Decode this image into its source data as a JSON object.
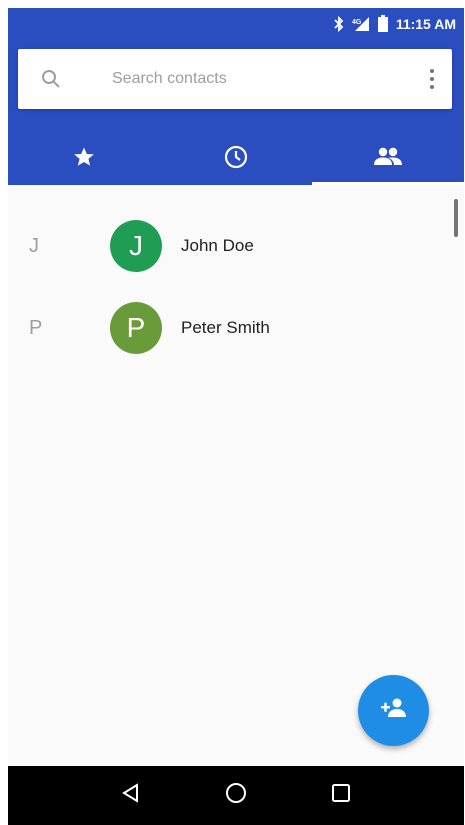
{
  "status_bar": {
    "time": "11:15 AM",
    "icons": [
      "bluetooth-icon",
      "signal-icon",
      "battery-icon"
    ]
  },
  "search": {
    "placeholder": "Search contacts"
  },
  "tabs": [
    {
      "icon": "star-icon",
      "name": "favorites",
      "selected": false
    },
    {
      "icon": "clock-icon",
      "name": "recents",
      "selected": false
    },
    {
      "icon": "people-icon",
      "name": "contacts",
      "selected": true
    }
  ],
  "contacts": [
    {
      "section": "J",
      "initial": "J",
      "name": "John Doe",
      "color": "#1f9d55"
    },
    {
      "section": "P",
      "initial": "P",
      "name": "Peter Smith",
      "color": "#6a9b3a"
    }
  ],
  "fab": {
    "icon": "add-contact-icon"
  },
  "nav": [
    "back-icon",
    "home-icon",
    "recents-icon"
  ],
  "colors": {
    "primary": "#2a4ec0",
    "accent": "#1f8ce6"
  }
}
